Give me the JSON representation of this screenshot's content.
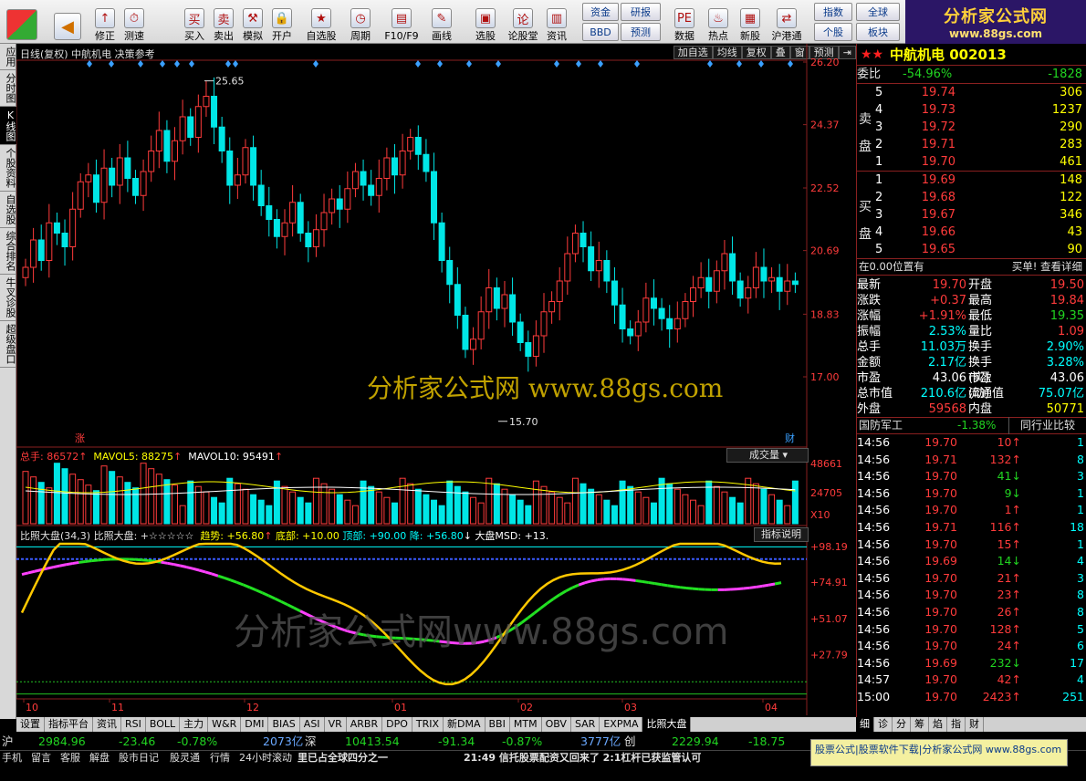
{
  "toolbar": {
    "buttons": [
      {
        "label": "修正",
        "icon": "↑"
      },
      {
        "label": "测速",
        "icon": "⏱"
      },
      {
        "label": "买入",
        "icon": "买"
      },
      {
        "label": "卖出",
        "icon": "卖"
      },
      {
        "label": "模拟",
        "icon": "⚒"
      },
      {
        "label": "开户",
        "icon": "🔒"
      },
      {
        "label": "自选股",
        "icon": "★"
      },
      {
        "label": "周期",
        "icon": "◷"
      },
      {
        "label": "F10/F9",
        "icon": "▤"
      },
      {
        "label": "画线",
        "icon": "✎"
      },
      {
        "label": "选股",
        "icon": "▣"
      },
      {
        "label": "论股堂",
        "icon": "论"
      },
      {
        "label": "资讯",
        "icon": "▥"
      },
      {
        "label": "数据",
        "icon": "PE"
      },
      {
        "label": "热点",
        "icon": "♨"
      },
      {
        "label": "新股",
        "icon": "▦"
      },
      {
        "label": "沪港通",
        "icon": "⇄"
      }
    ],
    "small": [
      "资金",
      "研报",
      "BBD",
      "预测",
      "指数",
      "全球",
      "个股",
      "板块"
    ],
    "logo_title": "分析家公式网",
    "logo_url": "www.88gs.com"
  },
  "left_tabs": [
    "应用",
    "分时图",
    "K线图",
    "个股资料",
    "自选股",
    "综合排名",
    "牛叉诊股",
    "超级盘口"
  ],
  "chart": {
    "header": "日线(复权)  中航机电  决策参考",
    "buttons": [
      "加自选",
      "均线",
      "复权",
      "叠",
      "窗",
      "预测",
      "⇥"
    ],
    "price_axis": [
      "26.20",
      "24.37",
      "22.52",
      "20.69",
      "18.83",
      "17.00"
    ],
    "high_label": "25.65",
    "low_label": "15.70",
    "tag_up": "涨",
    "tag_fin": "财",
    "watermark1": "分析家公式网  www.88gs.com",
    "watermark2": "分析家公式网www.88gs.com",
    "vol_header": {
      "total": "总手: 86572",
      "ma5": "MAVOL5: 88275",
      "ma10": "MAVOL10: 95491",
      "selector": "成交量"
    },
    "vol_axis": [
      "48661",
      "24705",
      "X10"
    ],
    "ind_header": {
      "name": "比照大盘(34,3)",
      "stars": "比照大盘: +☆☆☆☆☆",
      "trend": "趋势: +56.80",
      "bottom": "底部: +10.00",
      "top": "顶部: +90.00",
      "fall": "降: +56.80",
      "msd": "大盘MSD: +13.",
      "explain": "指标说明"
    },
    "ind_axis": [
      "+98.19",
      "+74.91",
      "+51.07",
      "+27.79"
    ],
    "date_axis": [
      "10",
      "11",
      "12",
      "01",
      "02",
      "03",
      "04"
    ]
  },
  "chart_data": {
    "type": "candlestick",
    "symbol": "中航机电",
    "period": "日线(复权)",
    "ylim": [
      15.0,
      26.2
    ],
    "high": 25.65,
    "low": 15.7,
    "x_months": [
      "10",
      "11",
      "12",
      "01",
      "02",
      "03",
      "04"
    ],
    "close": [
      20.2,
      21.0,
      20.4,
      21.5,
      21.2,
      20.8,
      21.9,
      22.7,
      22.9,
      22.1,
      23.1,
      22.6,
      23.4,
      22.8,
      22.3,
      23.0,
      23.6,
      24.2,
      23.3,
      23.9,
      24.6,
      24.0,
      24.9,
      25.2,
      24.3,
      23.6,
      22.6,
      22.9,
      23.7,
      22.6,
      22.0,
      21.6,
      21.1,
      21.5,
      22.1,
      21.2,
      20.8,
      21.3,
      21.8,
      22.2,
      21.9,
      22.5,
      23.0,
      22.6,
      22.3,
      22.8,
      23.4,
      22.9,
      23.6,
      24.0,
      23.5,
      23.0,
      21.5,
      20.4,
      19.7,
      18.8,
      17.8,
      18.1,
      18.9,
      19.6,
      19.0,
      19.4,
      18.6,
      18.0,
      17.6,
      18.2,
      18.9,
      19.2,
      19.8,
      20.6,
      21.2,
      20.8,
      20.1,
      20.4,
      19.8,
      19.1,
      18.4,
      18.2,
      18.6,
      19.3,
      19.0,
      18.7,
      18.4,
      18.7,
      19.2,
      19.6,
      19.9,
      19.5,
      20.1,
      20.6,
      19.8,
      19.3,
      19.6,
      20.2,
      19.8,
      19.9,
      19.5,
      19.8,
      19.7
    ],
    "volume_current": 86572,
    "ma5": 88275,
    "ma10": 95491,
    "indicator": {
      "name": "比照大盘(34,3)",
      "trend": 56.8,
      "bottom": 10.0,
      "top": 90.0,
      "fall": 56.8,
      "msd": 13.0
    }
  },
  "quote": {
    "title": "中航机电 002013",
    "webi": "委比",
    "webi_v": "-54.96%",
    "webi_diff": "-1828",
    "sell_label": "卖盘",
    "buy_label": "买盘",
    "sell": [
      [
        "5",
        "19.74",
        "306"
      ],
      [
        "4",
        "19.73",
        "1237"
      ],
      [
        "3",
        "19.72",
        "290"
      ],
      [
        "2",
        "19.71",
        "283"
      ],
      [
        "1",
        "19.70",
        "461"
      ]
    ],
    "buy": [
      [
        "1",
        "19.69",
        "148"
      ],
      [
        "2",
        "19.68",
        "122"
      ],
      [
        "3",
        "19.67",
        "346"
      ],
      [
        "4",
        "19.66",
        "43"
      ],
      [
        "5",
        "19.65",
        "90"
      ]
    ],
    "pos_text": "在0.00位置有",
    "pos_link": "买单! 查看详细",
    "stats": [
      [
        "最新",
        "19.70",
        "开盘",
        "19.50"
      ],
      [
        "涨跌",
        "+0.37",
        "最高",
        "19.84"
      ],
      [
        "涨幅",
        "+1.91%",
        "最低",
        "19.35"
      ],
      [
        "振幅",
        "2.53%",
        "量比",
        "1.09"
      ],
      [
        "总手",
        "11.03万",
        "换手",
        "2.90%"
      ],
      [
        "金额",
        "2.17亿",
        "换手(实)",
        "3.28%"
      ],
      [
        "市盈",
        "43.06",
        "市盈(动)",
        "43.06"
      ],
      [
        "总市值",
        "210.6亿",
        "流通值",
        "75.07亿"
      ],
      [
        "外盘",
        "59568",
        "内盘",
        "50771"
      ]
    ],
    "sector": "国防军工",
    "sector_chg": "-1.38%",
    "sector_btn": "同行业比较",
    "ticks": [
      [
        "14:56",
        "19.70",
        "10",
        "↑",
        "1"
      ],
      [
        "14:56",
        "19.71",
        "132",
        "↑",
        "8"
      ],
      [
        "14:56",
        "19.70",
        "41",
        "↓",
        "3"
      ],
      [
        "14:56",
        "19.70",
        "9",
        "↓",
        "1"
      ],
      [
        "14:56",
        "19.70",
        "1",
        "↑",
        "1"
      ],
      [
        "14:56",
        "19.71",
        "116",
        "↑",
        "18"
      ],
      [
        "14:56",
        "19.70",
        "15",
        "↑",
        "1"
      ],
      [
        "14:56",
        "19.69",
        "14",
        "↓",
        "4"
      ],
      [
        "14:56",
        "19.70",
        "21",
        "↑",
        "3"
      ],
      [
        "14:56",
        "19.70",
        "23",
        "↑",
        "8"
      ],
      [
        "14:56",
        "19.70",
        "26",
        "↑",
        "8"
      ],
      [
        "14:56",
        "19.70",
        "128",
        "↑",
        "5"
      ],
      [
        "14:56",
        "19.70",
        "24",
        "↑",
        "6"
      ],
      [
        "14:56",
        "19.69",
        "232",
        "↓",
        "17"
      ],
      [
        "14:57",
        "19.70",
        "42",
        "↑",
        "4"
      ],
      [
        "15:00",
        "19.70",
        "2423",
        "↑",
        "251"
      ]
    ]
  },
  "bottom_tabs": [
    "设置",
    "指标平台",
    "资讯",
    "RSI",
    "BOLL",
    "主力",
    "W&R",
    "DMI",
    "BIAS",
    "ASI",
    "VR",
    "ARBR",
    "DPO",
    "TRIX",
    "新DMA",
    "BBI",
    "MTM",
    "OBV",
    "SAR",
    "EXPMA",
    "比照大盘"
  ],
  "right_tabs": [
    "细",
    "诊",
    "分",
    "筹",
    "焰",
    "指",
    "财"
  ],
  "index_bar": {
    "sh": "沪",
    "sh_val": "2984.96",
    "sh_chg": "-23.46",
    "sh_pct": "-0.78%",
    "sh_amt": "2073亿",
    "sz": "深",
    "sz_val": "10413.54",
    "sz_chg": "-91.34",
    "sz_pct": "-0.87%",
    "sz_amt": "3777亿",
    "cy": "创",
    "cy_val": "2229.94",
    "cy_chg": "-18.75"
  },
  "status": {
    "items": [
      "手机",
      "留言",
      "客服",
      "解盘",
      "股市日记",
      "股灵通",
      "行情",
      "24小时滚动"
    ],
    "news1": "里已占全球四分之一",
    "news2": "21:49 信托股票配资又回来了 2:1杠杆已获监管认可",
    "ad": "股票公式|股票软件下载|分析家公式网  www.88gs.com"
  }
}
